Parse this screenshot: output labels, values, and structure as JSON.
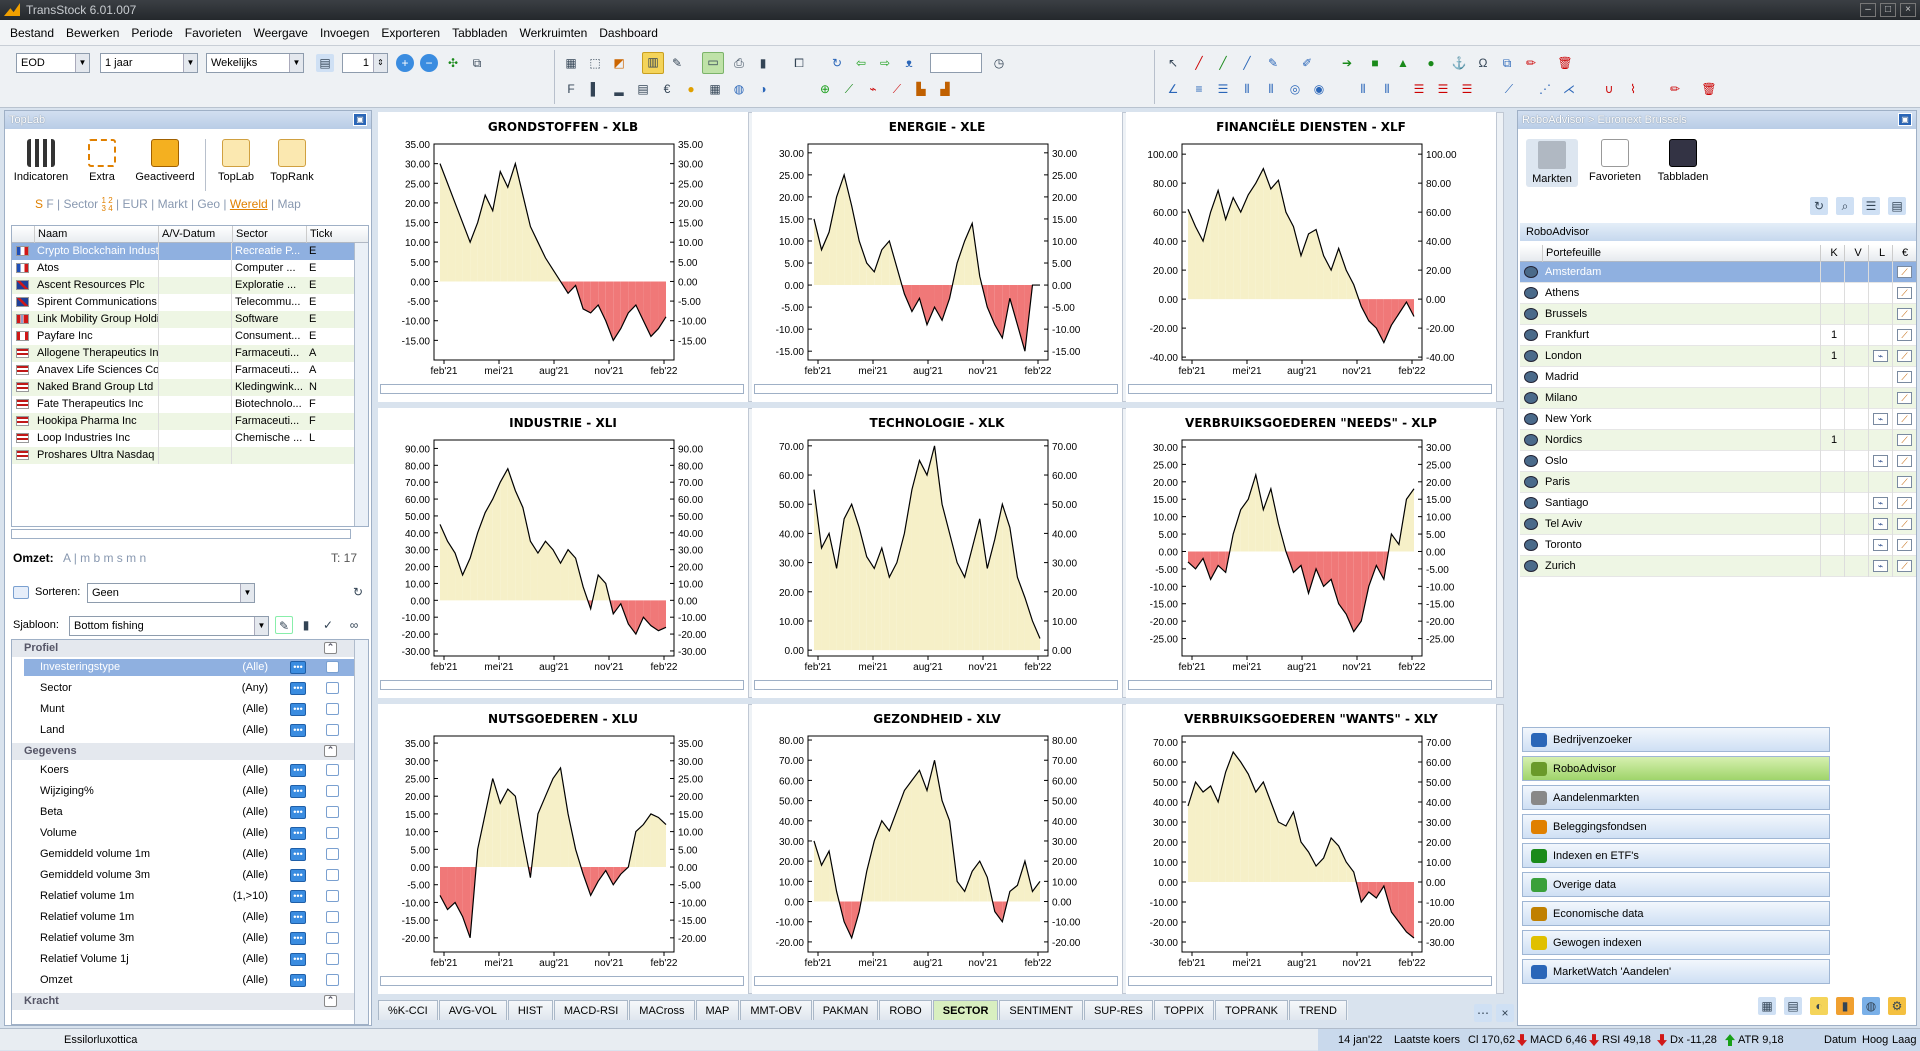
{
  "app": {
    "title": "TransStock 6.01.007"
  },
  "menu": [
    "Bestand",
    "Bewerken",
    "Periode",
    "Favorieten",
    "Weergave",
    "Invoegen",
    "Exporteren",
    "Tabbladen",
    "Werkruimten",
    "Dashboard"
  ],
  "toolbar": {
    "source": "EOD",
    "period": "1 jaar",
    "interval": "Wekelijks",
    "count": "1"
  },
  "toplab": {
    "title": "TopLab",
    "tools": [
      "Indicatoren",
      "Extra",
      "Geactiveerd",
      "TopLab",
      "TopRank"
    ],
    "filter_links": [
      "S",
      "F",
      "Sector",
      "1",
      "2",
      "3",
      "4",
      "EUR",
      "Markt",
      "Geo",
      "Wereld",
      "Map"
    ],
    "columns": [
      "Naam",
      "A/V-Datum",
      "Sector",
      "Ticke"
    ],
    "rows": [
      {
        "name": "Crypto Blockchain Industrie...",
        "sector": "Recreatie P...",
        "t": "E",
        "flag": "fr"
      },
      {
        "name": "Atos",
        "sector": "Computer ...",
        "t": "E",
        "flag": "fr"
      },
      {
        "name": "Ascent Resources Plc",
        "sector": "Exploratie ...",
        "t": "E",
        "flag": "uk"
      },
      {
        "name": "Spirent Communications Plc",
        "sector": "Telecommu...",
        "t": "E",
        "flag": "uk"
      },
      {
        "name": "Link Mobility Group Holding ...",
        "sector": "Software",
        "t": "E",
        "flag": "no"
      },
      {
        "name": "Payfare Inc",
        "sector": "Consument...",
        "t": "E",
        "flag": "ca"
      },
      {
        "name": "Allogene Therapeutics Inc",
        "sector": "Farmaceuti...",
        "t": "A",
        "flag": "us"
      },
      {
        "name": "Anavex Life Sciences Corp...",
        "sector": "Farmaceuti...",
        "t": "A",
        "flag": "us"
      },
      {
        "name": "Naked Brand Group Ltd",
        "sector": "Kledingwink...",
        "t": "N",
        "flag": "us"
      },
      {
        "name": "Fate Therapeutics Inc",
        "sector": "Biotechnolo...",
        "t": "F",
        "flag": "us"
      },
      {
        "name": "Hookipa Pharma Inc",
        "sector": "Farmaceuti...",
        "t": "F",
        "flag": "us"
      },
      {
        "name": "Loop Industries Inc",
        "sector": "Chemische ...",
        "t": "L",
        "flag": "us"
      },
      {
        "name": "Proshares Ultra Nasdaq Bio...",
        "sector": "",
        "t": "",
        "flag": "us"
      }
    ],
    "omzet_label": "Omzet:",
    "omzet_opts": "A | m b m s m n",
    "omzet_count": "T: 17",
    "sort_label": "Sorteren:",
    "sort_value": "Geen",
    "template_label": "Sjabloon:",
    "template_value": "Bottom fishing",
    "groups": [
      {
        "name": "Profiel",
        "items": [
          [
            "Investeringstype",
            "(Alle)"
          ],
          [
            "Sector",
            "(Any)"
          ],
          [
            "Munt",
            "(Alle)"
          ],
          [
            "Land",
            "(Alle)"
          ]
        ]
      },
      {
        "name": "Gegevens",
        "items": [
          [
            "Koers",
            "(Alle)"
          ],
          [
            "Wijziging%",
            "(Alle)"
          ],
          [
            "Beta",
            "(Alle)"
          ],
          [
            "Volume",
            "(Alle)"
          ],
          [
            "Gemiddeld volume 1m",
            "(Alle)"
          ],
          [
            "Gemiddeld volume 3m",
            "(Alle)"
          ],
          [
            "Relatief volume 1m",
            "(1,>10)"
          ],
          [
            "Relatief volume 1m",
            "(Alle)"
          ],
          [
            "Relatief volume 3m",
            "(Alle)"
          ],
          [
            "Relatief Volume 1j",
            "(Alle)"
          ],
          [
            "Omzet",
            "(Alle)"
          ]
        ]
      },
      {
        "name": "Kracht",
        "items": []
      }
    ]
  },
  "chart_data": [
    {
      "type": "area",
      "title": "GRONDSTOFFEN - XLB",
      "x": [
        "feb'21",
        "mei'21",
        "aug'21",
        "nov'21",
        "feb'22"
      ],
      "ylim": [
        -20,
        35
      ],
      "ticks": [
        35,
        30,
        25,
        20,
        15,
        10,
        5,
        0,
        -5,
        -10,
        -15
      ],
      "values": [
        30,
        25,
        20,
        15,
        10,
        15,
        22,
        18,
        28,
        24,
        30,
        22,
        14,
        10,
        6,
        3,
        0,
        -3,
        -1,
        -7,
        -8,
        -6,
        -10,
        -15,
        -12,
        -8,
        -6,
        -10,
        -14,
        -12,
        -9
      ]
    },
    {
      "type": "area",
      "title": "ENERGIE - XLE",
      "x": [
        "feb'21",
        "mei'21",
        "aug'21",
        "nov'21",
        "feb'22"
      ],
      "ylim": [
        -17,
        32
      ],
      "ticks": [
        30,
        25,
        20,
        15,
        10,
        5,
        0,
        -5,
        -10,
        -15
      ],
      "values": [
        15,
        8,
        12,
        20,
        25,
        18,
        10,
        5,
        3,
        8,
        10,
        4,
        -2,
        -6,
        -3,
        -9,
        -5,
        -8,
        -3,
        5,
        10,
        14,
        2,
        -5,
        -9,
        -12,
        -3,
        -9,
        -15,
        0,
        0
      ]
    },
    {
      "type": "area",
      "title": "FINANCIËLE DIENSTEN - XLF",
      "x": [
        "feb'21",
        "mei'21",
        "aug'21",
        "nov'21",
        "feb'22"
      ],
      "ylim": [
        -42,
        107
      ],
      "ticks": [
        100,
        80,
        60,
        40,
        20,
        0,
        -20,
        -40
      ],
      "values": [
        62,
        50,
        40,
        60,
        75,
        55,
        70,
        60,
        72,
        80,
        90,
        76,
        82,
        60,
        50,
        30,
        45,
        48,
        30,
        20,
        35,
        20,
        10,
        -5,
        -15,
        -20,
        -30,
        -18,
        -10,
        -2,
        -12
      ]
    },
    {
      "type": "area",
      "title": "INDUSTRIE - XLI",
      "x": [
        "feb'21",
        "mei'21",
        "aug'21",
        "nov'21",
        "feb'22"
      ],
      "ylim": [
        -33,
        95
      ],
      "ticks": [
        90,
        80,
        70,
        60,
        50,
        40,
        30,
        20,
        10,
        0,
        -10,
        -20,
        -30
      ],
      "values": [
        45,
        35,
        28,
        15,
        25,
        40,
        52,
        60,
        70,
        78,
        65,
        55,
        35,
        28,
        35,
        30,
        22,
        30,
        25,
        8,
        -5,
        15,
        10,
        -8,
        -2,
        -14,
        -20,
        -10,
        -15,
        -18,
        -16
      ]
    },
    {
      "type": "area",
      "title": "TECHNOLOGIE - XLK",
      "x": [
        "feb'21",
        "mei'21",
        "aug'21",
        "nov'21",
        "feb'22"
      ],
      "ylim": [
        -2,
        72
      ],
      "ticks": [
        70,
        60,
        50,
        40,
        30,
        20,
        10,
        0
      ],
      "values": [
        55,
        35,
        40,
        28,
        45,
        50,
        42,
        32,
        28,
        35,
        25,
        30,
        40,
        55,
        65,
        60,
        70,
        50,
        40,
        30,
        25,
        35,
        45,
        28,
        38,
        50,
        42,
        25,
        18,
        10,
        4
      ]
    },
    {
      "type": "area",
      "title": "VERBRUIKSGOEDEREN \"NEEDS\" - XLP",
      "x": [
        "feb'21",
        "mei'21",
        "aug'21",
        "nov'21",
        "feb'22"
      ],
      "ylim": [
        -30,
        32
      ],
      "ticks": [
        30,
        25,
        20,
        15,
        10,
        5,
        0,
        -5,
        -10,
        -15,
        -20,
        -25
      ],
      "values": [
        -3,
        -5,
        -2,
        -8,
        -4,
        -6,
        5,
        12,
        15,
        22,
        12,
        18,
        8,
        0,
        -6,
        -4,
        -12,
        -5,
        -10,
        -8,
        -15,
        -18,
        -23,
        -20,
        -10,
        -4,
        -8,
        5,
        2,
        15,
        18
      ]
    },
    {
      "type": "area",
      "title": "NUTSGOEDEREN - XLU",
      "x": [
        "feb'21",
        "mei'21",
        "aug'21",
        "nov'21",
        "feb'22"
      ],
      "ylim": [
        -24,
        37
      ],
      "ticks": [
        35,
        30,
        25,
        20,
        15,
        10,
        5,
        0,
        -5,
        -10,
        -15,
        -20
      ],
      "values": [
        -8,
        -12,
        -10,
        -14,
        -20,
        5,
        15,
        25,
        18,
        22,
        20,
        8,
        -3,
        15,
        20,
        25,
        28,
        15,
        5,
        -2,
        -8,
        -4,
        -1,
        -5,
        -2,
        0,
        10,
        12,
        15,
        14,
        12
      ]
    },
    {
      "type": "area",
      "title": "GEZONDHEID - XLV",
      "x": [
        "feb'21",
        "mei'21",
        "aug'21",
        "nov'21",
        "feb'22"
      ],
      "ylim": [
        -25,
        82
      ],
      "ticks": [
        80,
        70,
        60,
        50,
        40,
        30,
        20,
        10,
        0,
        -10,
        -20
      ],
      "values": [
        30,
        18,
        25,
        5,
        -10,
        -18,
        -5,
        15,
        30,
        40,
        35,
        45,
        55,
        60,
        65,
        55,
        70,
        50,
        40,
        10,
        5,
        15,
        20,
        12,
        -5,
        -10,
        5,
        8,
        20,
        5,
        10
      ]
    },
    {
      "type": "area",
      "title": "VERBRUIKSGOEDEREN \"WANTS\" - XLY",
      "x": [
        "feb'21",
        "mei'21",
        "aug'21",
        "nov'21",
        "feb'22"
      ],
      "ylim": [
        -35,
        73
      ],
      "ticks": [
        70,
        60,
        50,
        40,
        30,
        20,
        10,
        0,
        -10,
        -20,
        -30
      ],
      "values": [
        38,
        50,
        45,
        48,
        40,
        55,
        65,
        60,
        54,
        45,
        50,
        40,
        30,
        28,
        35,
        20,
        15,
        8,
        12,
        22,
        18,
        10,
        5,
        -10,
        -5,
        -8,
        -2,
        -15,
        -20,
        -25,
        -28
      ]
    }
  ],
  "tabs": [
    "%K-CCI",
    "AVG-VOL",
    "HIST",
    "MACD-RSI",
    "MACross",
    "MAP",
    "MMT-OBV",
    "PAKMAN",
    "ROBO",
    "SECTOR",
    "SENTIMENT",
    "SUP-RES",
    "TOPPIX",
    "TOPRANK",
    "TREND"
  ],
  "active_tab": "SECTOR",
  "robo": {
    "header": "RoboAdvisor > Euronext Brussels",
    "tools": [
      "Markten",
      "Favorieten",
      "Tabbladen"
    ],
    "section": "RoboAdvisor",
    "columns": [
      "Portefeuille",
      "K",
      "V",
      "L",
      "€"
    ],
    "rows": [
      {
        "name": "Amsterdam",
        "k": "",
        "chart": false
      },
      {
        "name": "Athens",
        "k": "",
        "chart": false
      },
      {
        "name": "Brussels",
        "k": "",
        "chart": false
      },
      {
        "name": "Frankfurt",
        "k": "1",
        "chart": false
      },
      {
        "name": "London",
        "k": "1",
        "chart": true
      },
      {
        "name": "Madrid",
        "k": "",
        "chart": false
      },
      {
        "name": "Milano",
        "k": "",
        "chart": false
      },
      {
        "name": "New York",
        "k": "",
        "chart": true
      },
      {
        "name": "Nordics",
        "k": "1",
        "chart": false
      },
      {
        "name": "Oslo",
        "k": "",
        "chart": true
      },
      {
        "name": "Paris",
        "k": "",
        "chart": false
      },
      {
        "name": "Santiago",
        "k": "",
        "chart": true
      },
      {
        "name": "Tel Aviv",
        "k": "",
        "chart": true
      },
      {
        "name": "Toronto",
        "k": "",
        "chart": true
      },
      {
        "name": "Zurich",
        "k": "",
        "chart": true
      }
    ],
    "nav": [
      "Bedrijvenzoeker",
      "RoboAdvisor",
      "Aandelenmarkten",
      "Beleggingsfondsen",
      "Indexen en ETF's",
      "Overige data",
      "Economische data",
      "Gewogen indexen",
      "MarketWatch 'Aandelen'"
    ]
  },
  "status": {
    "left": "Essilorluxottica",
    "date": "14 jan'22",
    "last": "Laatste koers",
    "cl": "Cl 170,62",
    "macd": "MACD 6,46",
    "rsi": "RSI 49,18",
    "dx": "Dx -11,28",
    "atr": "ATR 9,18",
    "datum": "Datum",
    "hoog": "Hoog",
    "laag": "Laag"
  },
  "colors": {
    "positive": "#f6f0c8",
    "negative": "#f07878",
    "accent": "#2a66b8",
    "selected": "#8fb0e0"
  }
}
